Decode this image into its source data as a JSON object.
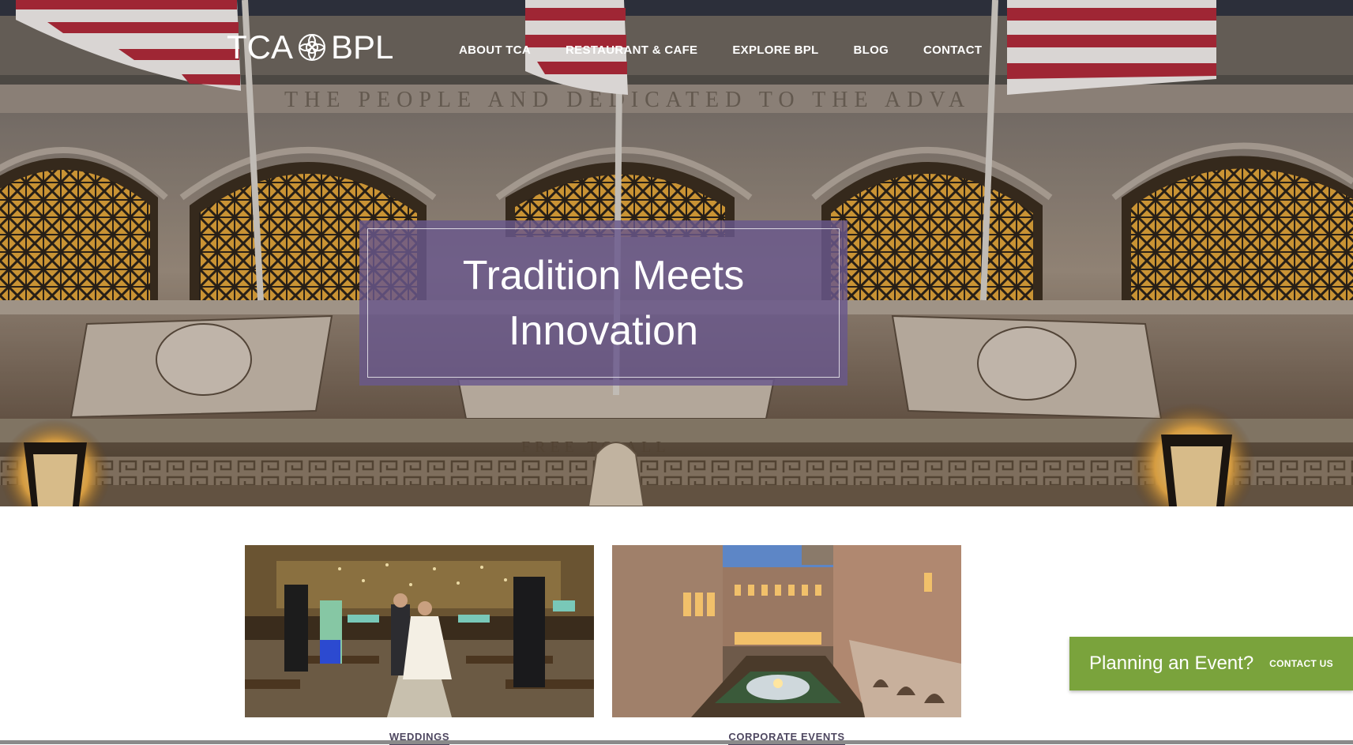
{
  "header": {
    "logo_left": "TCA",
    "logo_right": "BPL",
    "logo_icon": "rose-emblem-icon",
    "nav": [
      {
        "label": "ABOUT TCA"
      },
      {
        "label": "RESTAURANT & CAFE"
      },
      {
        "label": "EXPLORE BPL"
      },
      {
        "label": "BLOG"
      },
      {
        "label": "CONTACT"
      }
    ]
  },
  "hero": {
    "inscription": "…THE PEOPLE AND DEDICATED TO THE ADVA…",
    "banner_title": "Tradition Meets Innovation"
  },
  "cards": [
    {
      "label": "WEDDINGS"
    },
    {
      "label": "CORPORATE EVENTS"
    }
  ],
  "cta": {
    "text": "Planning an Event?",
    "link": "CONTACT US",
    "color": "#7aa33c"
  },
  "colors": {
    "banner": "#69588c",
    "label": "#4e4760"
  }
}
